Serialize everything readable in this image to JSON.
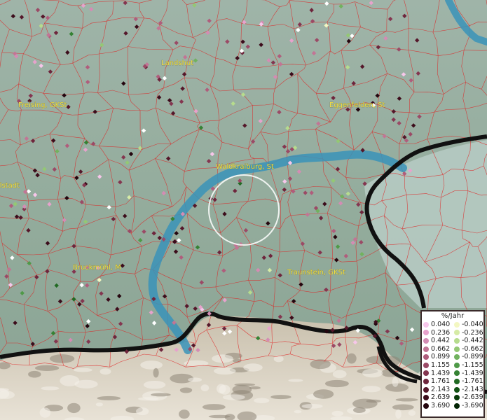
{
  "map": {
    "places": [
      {
        "name": "Landshut"
      },
      {
        "name": "Freising, GKSt"
      },
      {
        "name": "Eggenfelden, St"
      },
      {
        "name": "Waldkraiburg, St"
      },
      {
        "name": "Ingolstadt"
      },
      {
        "name": "Bruckmühl, M"
      },
      {
        "name": "Traunstein, GKSt"
      }
    ],
    "colors": {
      "river": "#3a93b8",
      "border": "#111111",
      "district_lines": "#e02020",
      "highlight_circle": "#ffffff"
    }
  },
  "legend": {
    "title": "%/Jahr",
    "positive": [
      {
        "label": "0.040",
        "color": "#f7c6ea"
      },
      {
        "label": "0.236",
        "color": "#e7a2cc"
      },
      {
        "label": "0.442",
        "color": "#d48cb4"
      },
      {
        "label": "0.662",
        "color": "#c27595"
      },
      {
        "label": "0.899",
        "color": "#b05d7c"
      },
      {
        "label": "1.155",
        "color": "#9b4a66"
      },
      {
        "label": "1.439",
        "color": "#843650"
      },
      {
        "label": "1.761",
        "color": "#6e253c"
      },
      {
        "label": "2.143",
        "color": "#55172a"
      },
      {
        "label": "2.639",
        "color": "#3c0c1b"
      },
      {
        "label": "3.690",
        "color": "#24050e"
      }
    ],
    "negative": [
      {
        "label": "-0.040",
        "color": "#f3f7c2"
      },
      {
        "label": "-0.236",
        "color": "#d6eba6"
      },
      {
        "label": "-0.442",
        "color": "#b6dc8d"
      },
      {
        "label": "-0.662",
        "color": "#94c874"
      },
      {
        "label": "-0.899",
        "color": "#71b25e"
      },
      {
        "label": "-1.155",
        "color": "#4f9a48"
      },
      {
        "label": "-1.439",
        "color": "#358234"
      },
      {
        "label": "-1.761",
        "color": "#216a23"
      },
      {
        "label": "-2.143",
        "color": "#125314"
      },
      {
        "label": "-2.639",
        "color": "#073b09"
      },
      {
        "label": "-3.690",
        "color": "#022403"
      }
    ]
  }
}
